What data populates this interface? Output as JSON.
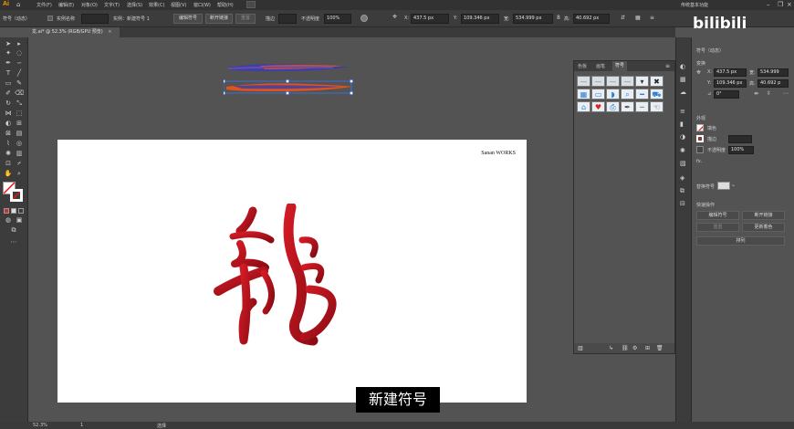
{
  "app": {
    "logo": "Ai",
    "workspace": "传统基本功能",
    "search_placeholder": ""
  },
  "menu": [
    "文件(F)",
    "编辑(E)",
    "对象(O)",
    "文字(T)",
    "选择(S)",
    "效果(C)",
    "视图(V)",
    "窗口(W)",
    "帮助(H)"
  ],
  "control_bar": {
    "object_type": "符号（动态）",
    "instance_name_label": "实例名称",
    "instance_name_value": "",
    "instance_of": "实例：新建符号 1",
    "edit_symbol": "编辑符号",
    "break_link": "断开链接",
    "reset": "重置",
    "opacity_label": "不透明度",
    "opacity": "100%",
    "x": "437.5 px",
    "y": "109.346 px",
    "w": "534.999 px",
    "h": "40.692 px",
    "x_label": "X:",
    "y_label": "Y:",
    "w_label": "宽:",
    "h_label": "高:"
  },
  "doc_tab": {
    "title": "龙.ai* @ 52.3% (RGB/GPU 预览)"
  },
  "artboard": {
    "brand": "Sanan WORKS",
    "logo_text": "Sanan"
  },
  "symbols_panel": {
    "tabs": [
      "色板",
      "画笔",
      "符号"
    ],
    "active_tab": "符号",
    "symbol_icons": [
      "brush-stroke-1",
      "brush-stroke-2",
      "brush-stroke-3",
      "brush-stroke-4",
      "dropdown-symbol",
      "close-symbol",
      "grid-symbol",
      "monitor-symbol",
      "rss-symbol",
      "magnifier-symbol",
      "minus-symbol",
      "cart-symbol",
      "home-symbol",
      "heart-symbol",
      "printer-symbol",
      "pen-symbol",
      "line-symbol",
      "hand-symbol"
    ]
  },
  "properties": {
    "header": "符号（动态）",
    "transform_label": "变换",
    "x": "437.5 px",
    "y": "109.346 px",
    "w": "534.999",
    "h": "40.692 p",
    "angle": "0°",
    "appearance_label": "外观",
    "fill_label": "填色",
    "stroke_label": "描边",
    "opacity_label": "不透明度",
    "opacity": "100%",
    "fx_label": "fx.",
    "replace_symbol_label": "替换符号",
    "quick_actions_label": "快速操作",
    "edit_symbol": "编辑符号",
    "break_link": "断开链接",
    "reset": "重置",
    "reset_color": "更新着色",
    "arrange": "排列"
  },
  "status": {
    "zoom": "52.3%",
    "page": "1",
    "tool": "选择"
  },
  "subtitle": "新建符号",
  "watermark": "bilibili",
  "colors": {
    "accent_orange": "#ff9a00",
    "dragon_red": "#b5121b",
    "panel": "#535353",
    "chrome": "#3c3c3c"
  }
}
